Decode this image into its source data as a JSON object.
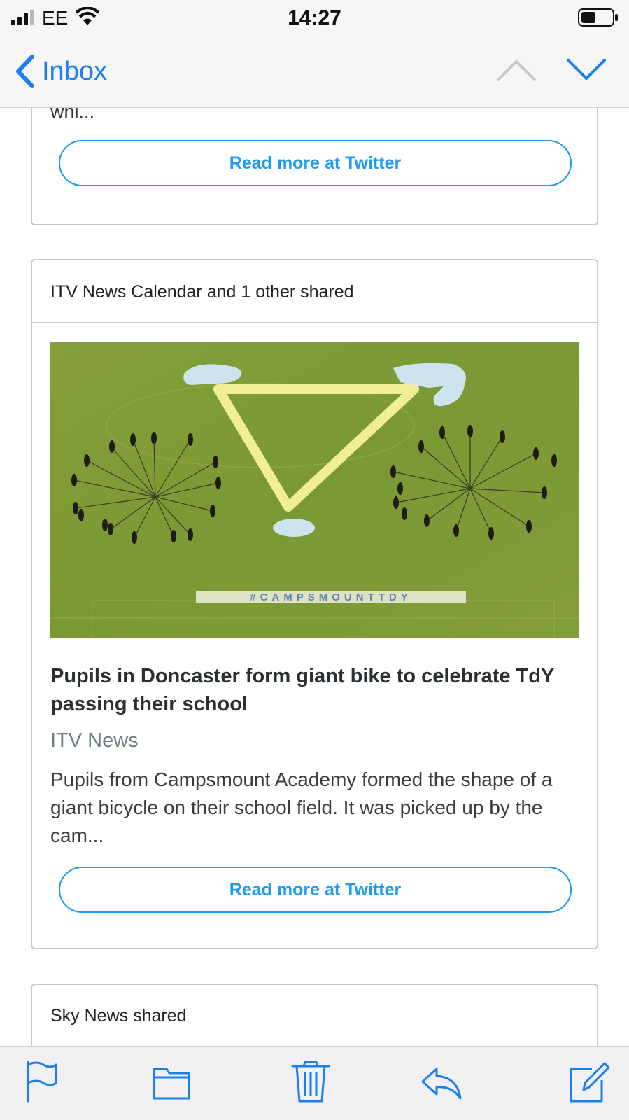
{
  "status_bar": {
    "carrier": "EE",
    "time": "14:27",
    "icons": [
      "signal-icon",
      "wifi-icon",
      "battery-icon"
    ]
  },
  "nav": {
    "back_label": "Inbox",
    "icons": [
      "chevron-left-icon",
      "chevron-up-icon",
      "chevron-down-icon"
    ]
  },
  "card_top": {
    "snippet": "wni...",
    "read_more": "Read more at Twitter"
  },
  "card_main": {
    "shared_by": "ITV News Calendar and 1 other shared",
    "image_hashtag": "#CAMPSMOUNTTDY",
    "title": "Pupils in Doncaster form giant bike to celebrate TdY passing their school",
    "source": "ITV News",
    "description": "Pupils from Campsmount Academy formed the shape of a giant bicycle on their school field. It was picked up by the cam...",
    "read_more": "Read more at Twitter"
  },
  "card_bottom": {
    "shared_by": "Sky News shared"
  },
  "toolbar": {
    "icons": [
      "flag-icon",
      "folder-icon",
      "trash-icon",
      "reply-icon",
      "compose-icon"
    ]
  },
  "colors": {
    "accent": "#1a7ff0",
    "twitter_blue": "#1d9bf0",
    "field_green": "#7e9a36",
    "bike_yellow": "#f3ef9a",
    "seat_blue": "#cfe6ef"
  }
}
